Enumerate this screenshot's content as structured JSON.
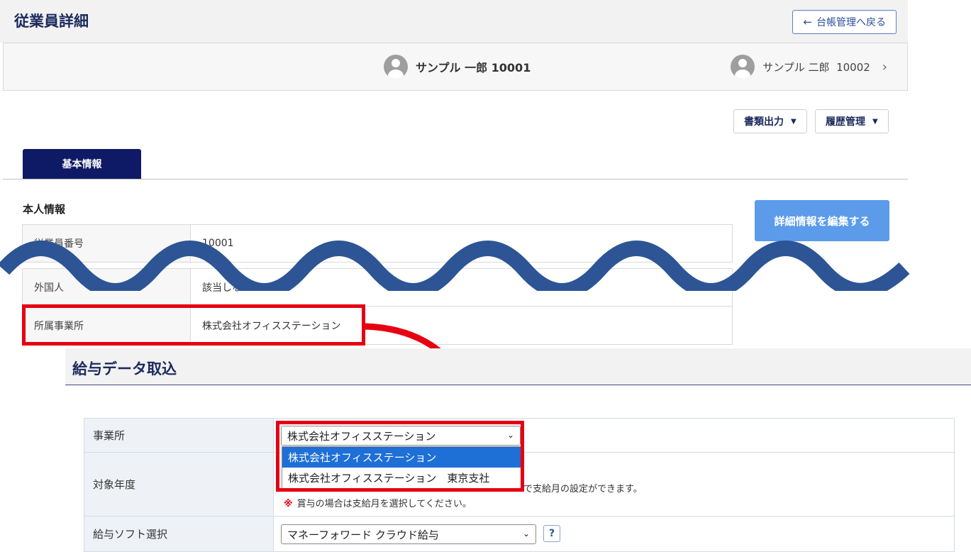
{
  "employee_detail": {
    "title": "従業員詳細",
    "back_button": "台帳管理へ戻る",
    "current_employee": "サンプル 一郎 10001",
    "next_employee": "サンプル 二郎  10002",
    "document_output": "書類出力",
    "history_management": "履歴管理",
    "tab_basic": "基本情報",
    "section_personal": "本人情報",
    "edit_button": "詳細情報を編集する",
    "rows": [
      {
        "label": "従業員番号",
        "value": "10001"
      },
      {
        "label": "外国人",
        "value": "該当しない"
      },
      {
        "label": "所属事業所",
        "value": "株式会社オフィスステーション"
      }
    ]
  },
  "payroll_import": {
    "title": "給与データ取込",
    "office_label": "事業所",
    "office_selected": "株式会社オフィスステーション",
    "office_options": [
      "株式会社オフィスステーション",
      "株式会社オフィスステーション　東京支社"
    ],
    "target_year_label": "対象年度",
    "note_partial": "で支給月の設定ができます。",
    "note_bonus_mark": "※",
    "note_bonus": "賞与の場合は支給月を選択してください。",
    "software_label": "給与ソフト選択",
    "software_selected": "マネーフォワード クラウド給与",
    "help_label": "?"
  },
  "colors": {
    "navy": "#0f1a66",
    "highlight_red": "#e60012",
    "wave_blue": "#2d5595",
    "edit_button_blue": "#5b9bea",
    "option_selected_blue": "#1e6fd6"
  }
}
